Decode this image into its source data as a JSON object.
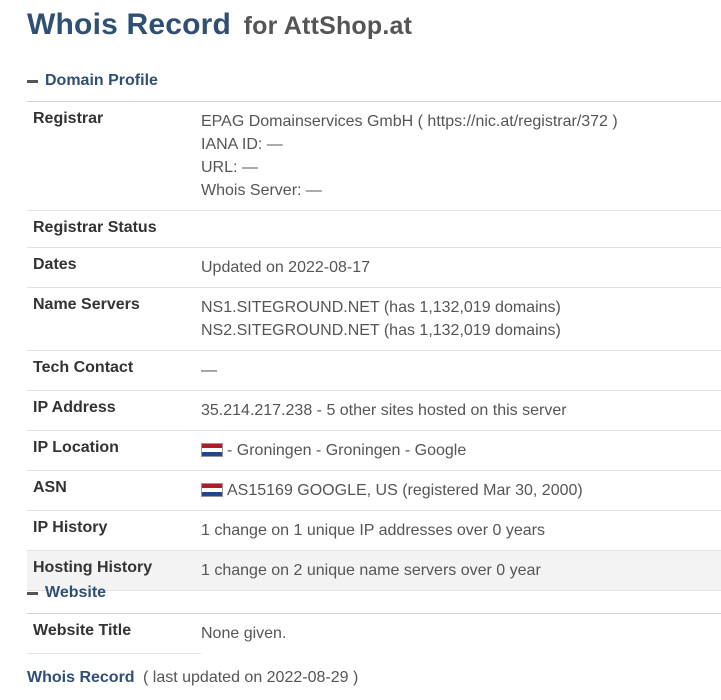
{
  "header": {
    "title": "Whois Record",
    "subtitle": "for AttShop.at"
  },
  "domain_profile": {
    "heading": "Domain Profile",
    "rows": [
      {
        "label": "Registrar",
        "lines": [
          "EPAG Domainservices GmbH ( https://nic.at/registrar/372 )",
          "IANA ID: —",
          "URL: —",
          "Whois Server: —"
        ]
      },
      {
        "label": "Registrar Status",
        "value": ""
      },
      {
        "label": "Dates",
        "value": "Updated on 2022-08-17"
      },
      {
        "label": "Name Servers",
        "lines": [
          "NS1.SITEGROUND.NET (has 1,132,019 domains)",
          "NS2.SITEGROUND.NET (has 1,132,019 domains)"
        ]
      },
      {
        "label": "Tech Contact",
        "value": "—"
      },
      {
        "label": "IP Address",
        "value": "35.214.217.238 - 5 other sites hosted on this server"
      },
      {
        "label": "IP Location",
        "value": "- Groningen - Groningen - Google",
        "flag": "flag-netherlands-icon"
      },
      {
        "label": "ASN",
        "value": "AS15169 GOOGLE, US (registered Mar 30, 2000)",
        "flag": "flag-netherlands-icon"
      },
      {
        "label": "IP History",
        "value": "1 change on 1 unique IP addresses over 0 years"
      },
      {
        "label": "Hosting History",
        "value": "1 change on 2 unique name servers over 0 year"
      }
    ]
  },
  "website": {
    "heading": "Website",
    "rows": [
      {
        "label": "Website Title",
        "value": "None given."
      }
    ]
  },
  "whois_record": {
    "title": "Whois Record",
    "note": "( last updated on 2022-08-29 )"
  },
  "colors": {
    "heading": "#2f4f74",
    "shaded_row": "#f3f3f3",
    "flag": [
      "#ae1c28",
      "#ffffff",
      "#21468b"
    ]
  }
}
